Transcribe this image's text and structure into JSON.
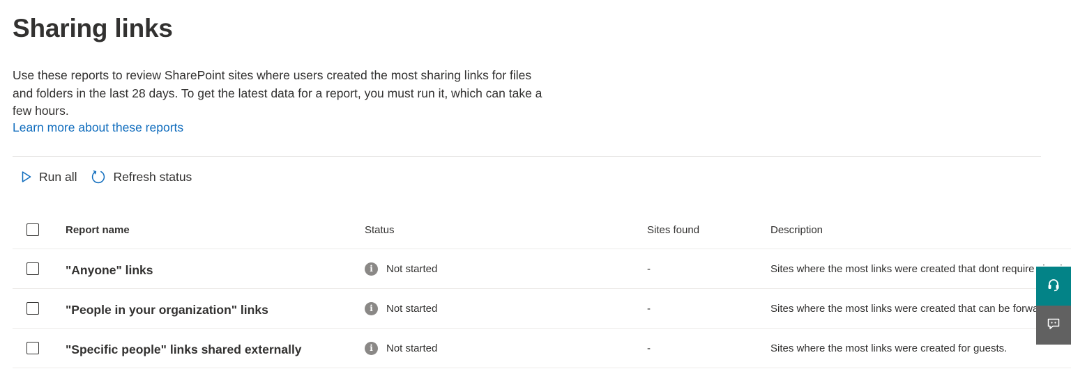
{
  "page": {
    "title": "Sharing links",
    "description": "Use these reports to review SharePoint sites where users created the most sharing links for files and folders in the last 28 days. To get the latest data for a report, you must run it, which can take a few hours.",
    "learn_more": "Learn more about these reports"
  },
  "toolbar": {
    "run_all_label": "Run all",
    "run_all_icon": "play-icon",
    "refresh_label": "Refresh status",
    "refresh_icon": "refresh-icon"
  },
  "table": {
    "columns": {
      "name": "Report name",
      "status": "Status",
      "sites": "Sites found",
      "description": "Description"
    },
    "rows": [
      {
        "name": "\"Anyone\" links",
        "status": "Not started",
        "status_icon": "info-icon",
        "sites": "-",
        "description": "Sites where the most links were created that dont require sign-in"
      },
      {
        "name": "\"People in your organization\" links",
        "status": "Not started",
        "status_icon": "info-icon",
        "sites": "-",
        "description": "Sites where the most links were created that can be forwarded"
      },
      {
        "name": "\"Specific people\" links shared externally",
        "status": "Not started",
        "status_icon": "info-icon",
        "sites": "-",
        "description": "Sites where the most links were created for guests."
      }
    ]
  },
  "side_panel": {
    "support_icon": "headset-icon",
    "feedback_icon": "feedback-icon"
  },
  "colors": {
    "link": "#0f6cbd",
    "accent": "#0f6cbd",
    "support_button": "#038387",
    "feedback_button": "#616161",
    "status_icon": "#8a8886"
  }
}
